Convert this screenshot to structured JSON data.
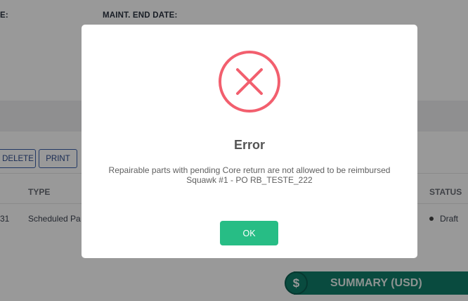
{
  "background": {
    "fields": {
      "start_date_label": "E:",
      "end_date_label": "MAINT. END DATE:"
    },
    "toolbar": {
      "delete_label": "DELETE",
      "print_label": "PRINT"
    },
    "table": {
      "columns": {
        "type": "TYPE",
        "status": "STATUS"
      },
      "rows": [
        {
          "id": "31",
          "type": "Scheduled Pa",
          "status": "Draft"
        }
      ]
    },
    "summary": {
      "label": "SUMMARY (USD)",
      "icon_glyph": "$",
      "icon": "dollar-icon"
    }
  },
  "modal": {
    "icon": "error-x-icon",
    "title": "Error",
    "message_line1": "Repairable parts with pending Core return are not allowed to be reimbursed",
    "message_line2": "Squawk #1 - PO RB_TESTE_222",
    "ok_label": "OK"
  },
  "colors": {
    "error": "#f25f6e",
    "ok_button": "#27bd85",
    "summary": "#0f7e6a"
  }
}
